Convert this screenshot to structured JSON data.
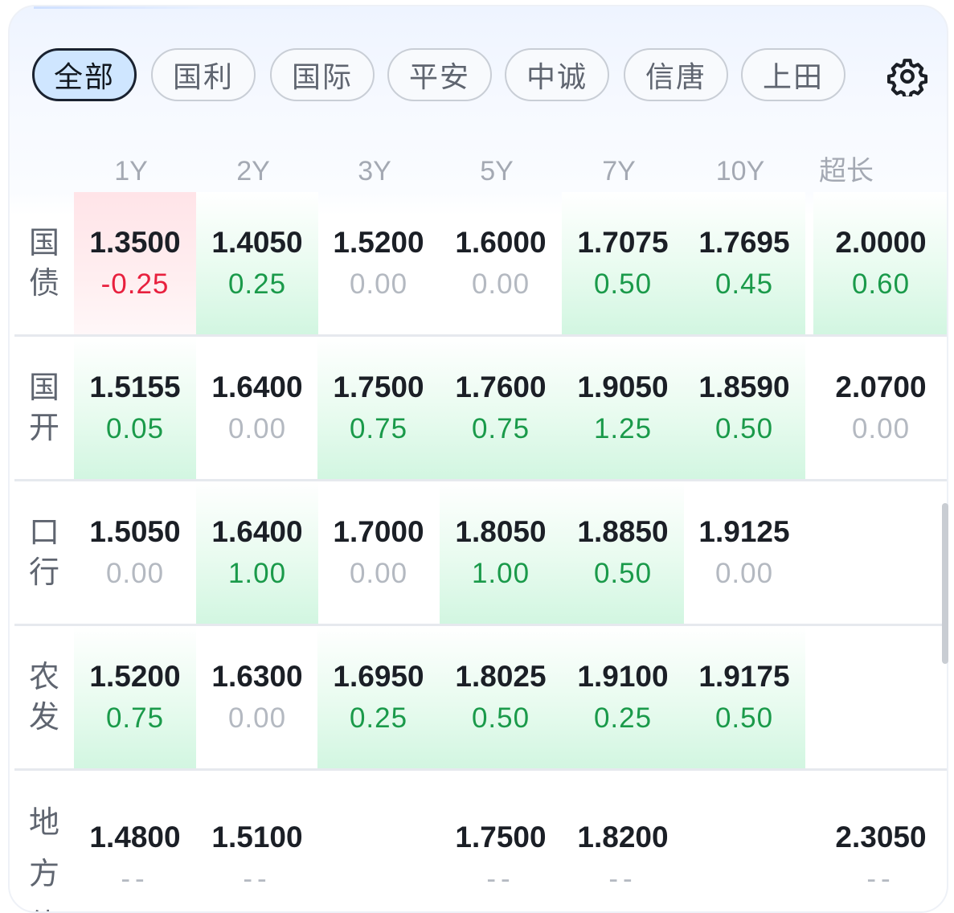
{
  "tabs": [
    {
      "label": "全部",
      "active": true
    },
    {
      "label": "国利",
      "active": false
    },
    {
      "label": "国际",
      "active": false
    },
    {
      "label": "平安",
      "active": false
    },
    {
      "label": "中诚",
      "active": false
    },
    {
      "label": "信唐",
      "active": false
    },
    {
      "label": "上田",
      "active": false
    }
  ],
  "settings_icon": "gear-icon",
  "columns": [
    "1Y",
    "2Y",
    "3Y",
    "5Y",
    "7Y",
    "10Y",
    "超长"
  ],
  "colors": {
    "up": "#1a9a4a",
    "down": "#e8203e",
    "flat": "#b4b9c1",
    "active_tab_bg": "#cfe6ff"
  },
  "rows": [
    {
      "label": [
        "国",
        "债"
      ],
      "cells": [
        {
          "rate": "1.3500",
          "chg": "-0.25",
          "dir": "down"
        },
        {
          "rate": "1.4050",
          "chg": "0.25",
          "dir": "up"
        },
        {
          "rate": "1.5200",
          "chg": "0.00",
          "dir": "flat"
        },
        {
          "rate": "1.6000",
          "chg": "0.00",
          "dir": "flat"
        },
        {
          "rate": "1.7075",
          "chg": "0.50",
          "dir": "up"
        },
        {
          "rate": "1.7695",
          "chg": "0.45",
          "dir": "up"
        },
        {
          "rate": "2.0000",
          "chg": "0.60",
          "dir": "up"
        }
      ]
    },
    {
      "label": [
        "国",
        "开"
      ],
      "cells": [
        {
          "rate": "1.5155",
          "chg": "0.05",
          "dir": "up"
        },
        {
          "rate": "1.6400",
          "chg": "0.00",
          "dir": "flat"
        },
        {
          "rate": "1.7500",
          "chg": "0.75",
          "dir": "up"
        },
        {
          "rate": "1.7600",
          "chg": "0.75",
          "dir": "up"
        },
        {
          "rate": "1.9050",
          "chg": "1.25",
          "dir": "up"
        },
        {
          "rate": "1.8590",
          "chg": "0.50",
          "dir": "up"
        },
        {
          "rate": "2.0700",
          "chg": "0.00",
          "dir": "flat"
        }
      ]
    },
    {
      "label": [
        "口",
        "行"
      ],
      "cells": [
        {
          "rate": "1.5050",
          "chg": "0.00",
          "dir": "flat"
        },
        {
          "rate": "1.6400",
          "chg": "1.00",
          "dir": "up"
        },
        {
          "rate": "1.7000",
          "chg": "0.00",
          "dir": "flat"
        },
        {
          "rate": "1.8050",
          "chg": "1.00",
          "dir": "up"
        },
        {
          "rate": "1.8850",
          "chg": "0.50",
          "dir": "up"
        },
        {
          "rate": "1.9125",
          "chg": "0.00",
          "dir": "flat"
        },
        {
          "rate": "",
          "chg": "",
          "dir": "empty"
        }
      ]
    },
    {
      "label": [
        "农",
        "发"
      ],
      "cells": [
        {
          "rate": "1.5200",
          "chg": "0.75",
          "dir": "up"
        },
        {
          "rate": "1.6300",
          "chg": "0.00",
          "dir": "flat"
        },
        {
          "rate": "1.6950",
          "chg": "0.25",
          "dir": "up"
        },
        {
          "rate": "1.8025",
          "chg": "0.50",
          "dir": "up"
        },
        {
          "rate": "1.9100",
          "chg": "0.25",
          "dir": "up"
        },
        {
          "rate": "1.9175",
          "chg": "0.50",
          "dir": "up"
        },
        {
          "rate": "",
          "chg": "",
          "dir": "empty"
        }
      ]
    },
    {
      "label": [
        "地",
        "方",
        "债"
      ],
      "cells": [
        {
          "rate": "1.4800",
          "chg": "--",
          "dir": "na"
        },
        {
          "rate": "1.5100",
          "chg": "--",
          "dir": "na"
        },
        {
          "rate": "",
          "chg": "",
          "dir": "empty"
        },
        {
          "rate": "1.7500",
          "chg": "--",
          "dir": "na"
        },
        {
          "rate": "1.8200",
          "chg": "--",
          "dir": "na"
        },
        {
          "rate": "",
          "chg": "",
          "dir": "empty"
        },
        {
          "rate": "2.3050",
          "chg": "--",
          "dir": "na"
        }
      ]
    }
  ]
}
